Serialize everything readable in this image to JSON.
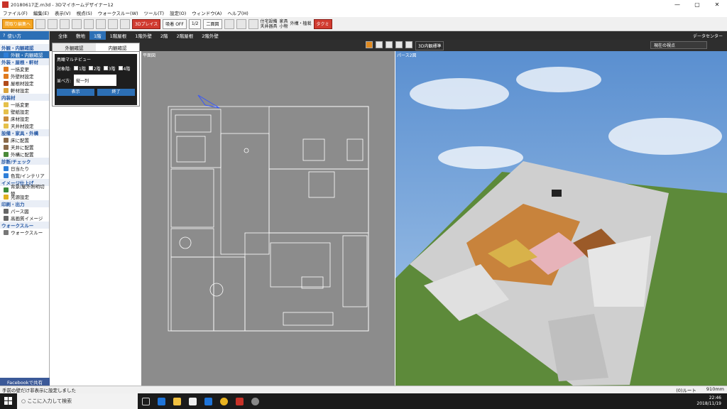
{
  "window": {
    "title": "20180617正.m3d - 3Dマイホームデザイナー12",
    "min": "—",
    "max": "▢",
    "close": "✕"
  },
  "menu": [
    "ファイル(F)",
    "編集(E)",
    "表示(V)",
    "視点(S)",
    "ウォークスルー(W)",
    "ツール(T)",
    "設定(O)",
    "ウィンドウ(A)",
    "ヘルプ(H)"
  ],
  "toolbar": {
    "edit_button": "間取り編集へ",
    "place_3d": "3Dプレイス",
    "hide_off": "吸着 OFF",
    "scale": "1/2",
    "view_mode": "二面図",
    "checks_a": [
      "住宅設備",
      "天井器具"
    ],
    "checks_b": [
      "家具",
      "小物"
    ],
    "checks_c": [
      "外構・植栽"
    ],
    "takumi": "タクミ"
  },
  "left": {
    "help": "使い方",
    "sections": [
      {
        "title": "外観・内観確認",
        "items": [
          {
            "label": "外観・内観確認",
            "selected": true,
            "color": "#2f7fd8"
          }
        ]
      },
      {
        "title": "外装・屋根・軒材",
        "items": [
          {
            "label": "一括変更",
            "color": "#e07a1f"
          },
          {
            "label": "外壁材設定",
            "color": "#e07a1f"
          },
          {
            "label": "屋根材設定",
            "color": "#b24b1a"
          },
          {
            "label": "軒材設定",
            "color": "#d9a23b"
          }
        ]
      },
      {
        "title": "内装材",
        "items": [
          {
            "label": "一括変更",
            "color": "#e5c04a"
          },
          {
            "label": "壁紙設定",
            "color": "#e5c04a"
          },
          {
            "label": "床材設定",
            "color": "#c98a3a"
          },
          {
            "label": "天井材設定",
            "color": "#e5c04a"
          }
        ]
      },
      {
        "title": "設備・家具・外構",
        "items": [
          {
            "label": "床に配置",
            "color": "#8a6a4a"
          },
          {
            "label": "天井に配置",
            "color": "#8a6a4a"
          },
          {
            "label": "外構に配置",
            "color": "#4a8a3a"
          }
        ]
      },
      {
        "title": "診断/チェック",
        "items": [
          {
            "label": "日当たり",
            "color": "#2f7fd8"
          },
          {
            "label": "色覚/インテリア",
            "color": "#2f7fd8"
          }
        ]
      },
      {
        "title": "イメージ仕上げ",
        "items": [
          {
            "label": "背景/屋外照明切替",
            "color": "#3a8a3a"
          },
          {
            "label": "光源設定",
            "color": "#e0b020"
          }
        ]
      },
      {
        "title": "印刷・出力",
        "items": [
          {
            "label": "パース図",
            "color": "#666"
          },
          {
            "label": "高画質イメージ",
            "color": "#666"
          }
        ]
      },
      {
        "title": "ウォークスルー",
        "items": [
          {
            "label": "ウォークスルー",
            "color": "#777"
          }
        ]
      }
    ],
    "facebook": "Facebookで共有"
  },
  "tabs": [
    "全体",
    "敷地",
    "1階",
    "1階屋根",
    "1階外壁",
    "2階",
    "2階屋根",
    "2階外壁"
  ],
  "active_tab": "1階",
  "data_center": "データセンター",
  "dialog": {
    "tab1": "外観確認",
    "tab2": "内観確認",
    "heading": "鳥瞰マルチビュー",
    "target": "対象階:",
    "floors": [
      "1階",
      "2階",
      "3階",
      "4階"
    ],
    "arrange": "並べ方:",
    "arrange_value": "縦一列",
    "show": "表示",
    "close": "終了"
  },
  "plan_label": "平面図",
  "pers_label": "パース2図",
  "pers_toolbar": {
    "view_dropdown": "3D内観標準",
    "viewpoint": "現在の視点"
  },
  "status": {
    "message": "手前の壁だけ非表示に設定しました",
    "right1": "(0)ルート",
    "right2": "910mm"
  },
  "taskbar": {
    "search": "ここに入力して検索",
    "time": "22:46",
    "date": "2018/11/19"
  }
}
